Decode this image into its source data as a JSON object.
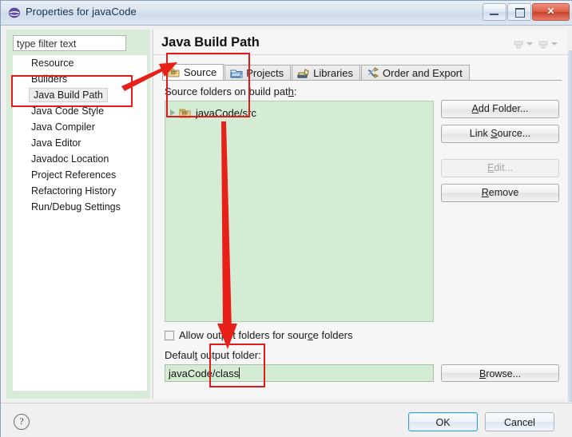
{
  "window": {
    "title": "Properties for javaCode",
    "icon": "eclipse-icon",
    "controls": {
      "minimize": "minimize-icon",
      "maximize": "maximize-icon",
      "close": "✕"
    }
  },
  "left_pane": {
    "filter": {
      "value": "type filter text",
      "placeholder": "type filter text"
    },
    "tree_items": [
      {
        "label": "Resource",
        "selected": false
      },
      {
        "label": "Builders",
        "selected": false
      },
      {
        "label": "Java Build Path",
        "selected": true
      },
      {
        "label": "Java Code Style",
        "selected": false
      },
      {
        "label": "Java Compiler",
        "selected": false
      },
      {
        "label": "Java Editor",
        "selected": false
      },
      {
        "label": "Javadoc Location",
        "selected": false
      },
      {
        "label": "Project References",
        "selected": false
      },
      {
        "label": "Refactoring History",
        "selected": false
      },
      {
        "label": "Run/Debug Settings",
        "selected": false
      }
    ]
  },
  "right_pane": {
    "page_title": "Java Build Path",
    "nav": {
      "back": "back-icon",
      "forward": "forward-icon"
    },
    "tabs": [
      {
        "label": "Source",
        "icon": "source-folder-icon",
        "active": true
      },
      {
        "label": "Projects",
        "icon": "projects-folder-icon",
        "active": false
      },
      {
        "label": "Libraries",
        "icon": "libraries-icon",
        "active": false
      },
      {
        "label": "Order and Export",
        "icon": "order-export-icon",
        "active": false
      }
    ],
    "source_section": {
      "label_pre": "Source folders on build pat",
      "label_mnemonic": "h",
      "label_post": ":",
      "entries": [
        {
          "label": "javaCode/src",
          "icon": "package-folder-icon",
          "expandable": true
        }
      ],
      "buttons": [
        {
          "label_pre": "",
          "mnemonic": "A",
          "label_post": "dd Folder...",
          "id": "add-folder-button",
          "enabled": true
        },
        {
          "label_pre": "Link ",
          "mnemonic": "S",
          "label_post": "ource...",
          "id": "link-source-button",
          "enabled": true
        },
        {
          "label_pre": "",
          "mnemonic": "E",
          "label_post": "dit...",
          "id": "edit-button",
          "enabled": false
        },
        {
          "label_pre": "",
          "mnemonic": "R",
          "label_post": "emove",
          "id": "remove-button",
          "enabled": true
        }
      ]
    },
    "allow_output": {
      "label_pre": "Allow output folders for sour",
      "label_mnemonic": "c",
      "label_post": "e folders",
      "checked": false
    },
    "default_output": {
      "label_pre": "Defaul",
      "label_mnemonic": "t",
      "label_post": " output folder:",
      "value": "javaCode/class",
      "browse_pre": "",
      "browse_mnemonic": "B",
      "browse_post": "rowse..."
    }
  },
  "footer": {
    "help": "?",
    "ok": "OK",
    "cancel": "Cancel"
  },
  "annotations": {
    "accent_color": "#e01b1b",
    "boxes": [
      {
        "name": "tree-highlight-box"
      },
      {
        "name": "source-tab-box"
      },
      {
        "name": "output-folder-box"
      }
    ],
    "arrows": [
      {
        "name": "arrow-to-source-tab"
      },
      {
        "name": "arrow-to-output-folder"
      }
    ]
  }
}
